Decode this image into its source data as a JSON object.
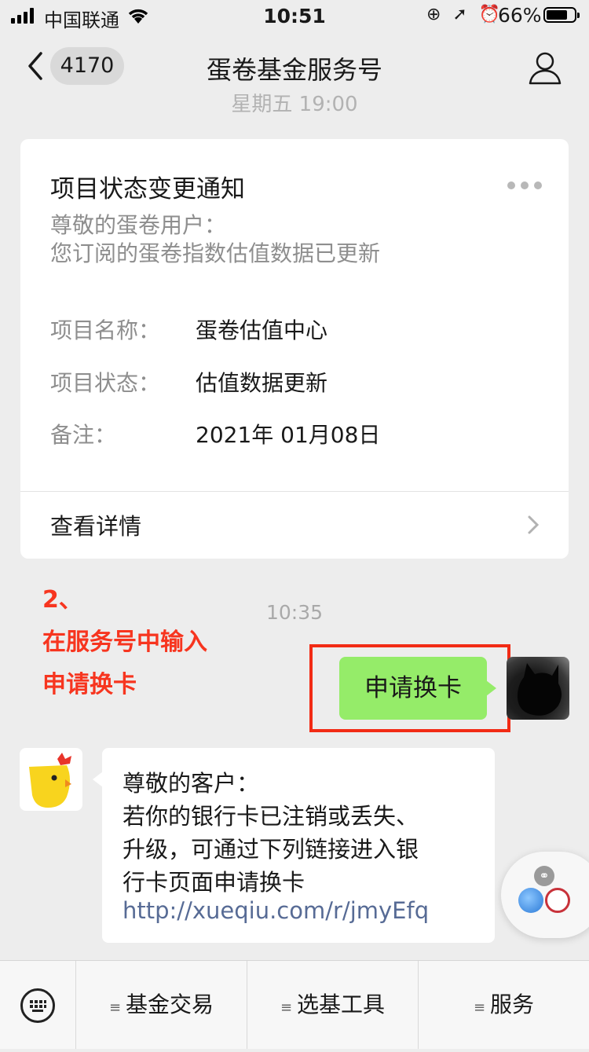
{
  "status_bar": {
    "carrier": "中国联通",
    "time": "10:51",
    "indicators": "⊕ ➚ ⏰",
    "battery": "66%"
  },
  "nav": {
    "back_count": "4170",
    "title": "蛋卷基金服务号"
  },
  "messages": {
    "time_top": "星期五 19:00",
    "notice_card": {
      "title": "项目状态变更通知",
      "greeting_line1": "尊敬的蛋卷用户：",
      "greeting_line2": "您订阅的蛋卷指数估值数据已更新",
      "fields": [
        {
          "key": "项目名称：",
          "value": "蛋卷估值中心"
        },
        {
          "key": "项目状态：",
          "value": "估值数据更新"
        },
        {
          "key": "备注：",
          "value": "2021年 01月08日"
        }
      ],
      "detail_link": "查看详情"
    },
    "time_2": "10:35",
    "sent_message": "申请换卡",
    "reply": {
      "line1": "尊敬的客户：",
      "line2": "若你的银行卡已注销或丢失、",
      "line3": "升级，可通过下列链接进入银",
      "line4": "行卡页面申请换卡",
      "link": "http://xueqiu.com/r/jmyEfq"
    }
  },
  "annotation": {
    "line1": "2、",
    "line2": "在服务号中输入",
    "line3": "申请换卡"
  },
  "bottom_menu": {
    "items": [
      "基金交易",
      "选基工具",
      "服务"
    ]
  },
  "colors": {
    "sent_bubble": "#95ec69",
    "link": "#576b95",
    "annotation": "#f7351f",
    "highlight_box": "#f22b15"
  }
}
